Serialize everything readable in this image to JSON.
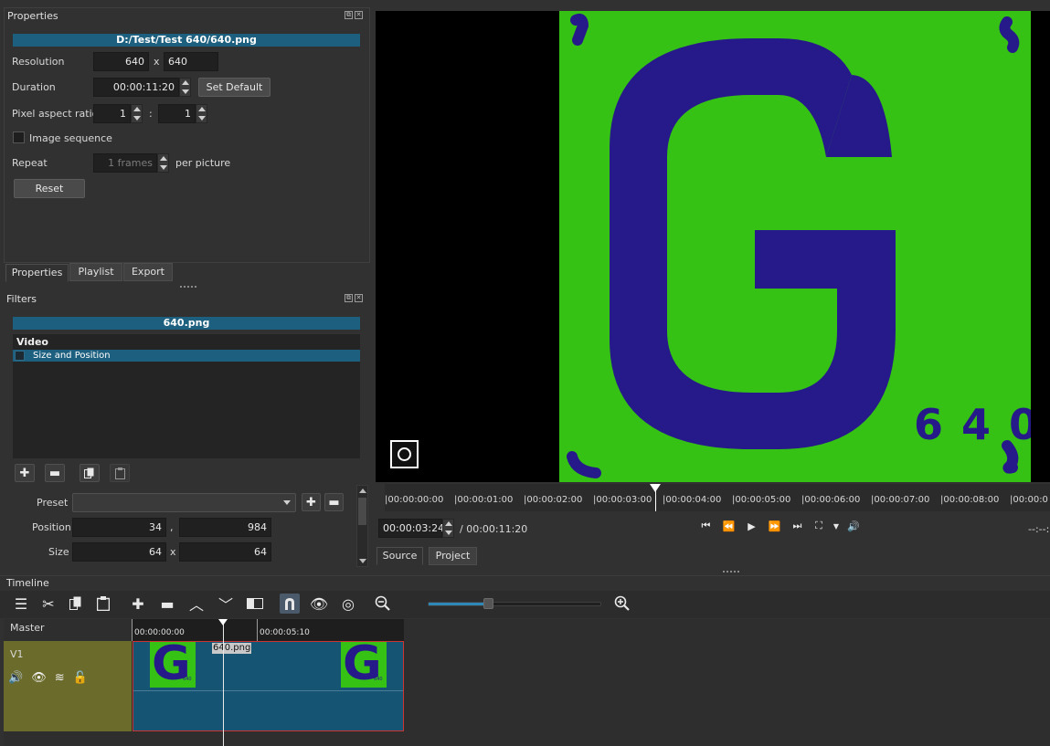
{
  "properties": {
    "title": "Properties",
    "file_path": "D:/Test/Test 640/640.png",
    "resolution_label": "Resolution",
    "resolution_w": "640",
    "resolution_x": "x",
    "resolution_h": "640",
    "duration_label": "Duration",
    "duration_value": "00:00:11:20",
    "set_default_label": "Set Default",
    "par_label": "Pixel aspect ratio",
    "par_num": "1",
    "par_sep": ":",
    "par_den": "1",
    "image_sequence_label": "Image sequence",
    "repeat_label": "Repeat",
    "repeat_value": "1 frames",
    "per_picture_label": "per picture",
    "reset_label": "Reset"
  },
  "left_tabs": [
    "Properties",
    "Playlist",
    "Export"
  ],
  "filters": {
    "title": "Filters",
    "clip_name": "640.png",
    "category": "Video",
    "items": [
      "Size and Position"
    ],
    "preset_label": "Preset",
    "position_label": "Position",
    "position_x": "34",
    "position_sep": ",",
    "position_y": "984",
    "size_label": "Size",
    "size_w": "64",
    "size_sep": "x",
    "size_h": "64"
  },
  "viewer": {
    "glyph": "G",
    "caption": "6 4 0",
    "ruler_labels": [
      "|00:00:00:00",
      "|00:00:01:00",
      "|00:00:02:00",
      "|00:00:03:00",
      "|00:00:04:00",
      "|00:00:05:00",
      "|00:00:06:00",
      "|00:00:07:00",
      "|00:00:08:00",
      "|00:00:0"
    ],
    "current_time": "00:00:03:24",
    "total_time": "/ 00:00:11:20",
    "right_time": "--:--:",
    "tabs": [
      "Source",
      "Project"
    ]
  },
  "timeline": {
    "title": "Timeline",
    "master_label": "Master",
    "ruler_labels": [
      "00:00:00:00",
      "00:00:05:10"
    ],
    "track_name": "V1",
    "clip_label": "640.png",
    "thumb_glyph": "G",
    "thumb_caption": "640"
  },
  "colors": {
    "accent": "#1d5f7e",
    "image_green": "#36c214",
    "image_blue": "#261a8a",
    "track_header": "#6b6b2b",
    "clip_body": "#165473",
    "clip_border": "#cc3333"
  }
}
